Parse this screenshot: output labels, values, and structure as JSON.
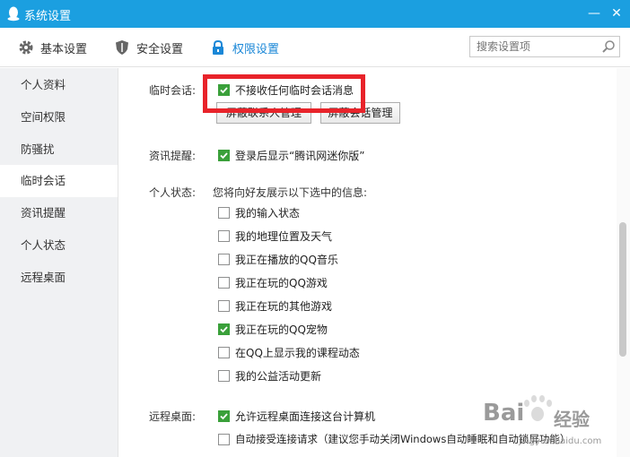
{
  "window": {
    "title": "系统设置",
    "minimize_glyph": "—",
    "close_glyph": "✕"
  },
  "toolbar": {
    "tabs": [
      {
        "label": "基本设置",
        "icon": "gear-icon"
      },
      {
        "label": "安全设置",
        "icon": "shield-icon"
      },
      {
        "label": "权限设置",
        "icon": "lock-icon"
      }
    ],
    "active_tab": 2,
    "search_placeholder": "搜索设置项"
  },
  "sidebar": {
    "items": [
      "个人资料",
      "空间权限",
      "防骚扰",
      "临时会话",
      "资讯提醒",
      "个人状态",
      "远程桌面"
    ],
    "active_index": 3
  },
  "sections": {
    "temp_session": {
      "label": "临时会话:",
      "option": {
        "text": "不接收任何临时会话消息",
        "checked": true
      },
      "buttons": [
        "屏蔽联系人管理",
        "屏蔽会话管理"
      ]
    },
    "news": {
      "label": "资讯提醒:",
      "option": {
        "text": "登录后显示“腾讯网迷你版”",
        "checked": true
      }
    },
    "status": {
      "label": "个人状态:",
      "intro": "您将向好友展示以下选中的信息:",
      "options": [
        {
          "text": "我的输入状态",
          "checked": false
        },
        {
          "text": "我的地理位置及天气",
          "checked": false
        },
        {
          "text": "我正在播放的QQ音乐",
          "checked": false
        },
        {
          "text": "我正在玩的QQ游戏",
          "checked": false
        },
        {
          "text": "我正在玩的其他游戏",
          "checked": false
        },
        {
          "text": "我正在玩的QQ宠物",
          "checked": true
        },
        {
          "text": "在QQ上显示我的课程动态",
          "checked": false
        },
        {
          "text": "我的公益活动更新",
          "checked": false
        }
      ]
    },
    "remote": {
      "label": "远程桌面:",
      "options": [
        {
          "text": "允许远程桌面连接这台计算机",
          "checked": true
        },
        {
          "text": "自动接受连接请求（建议您手动关闭Windows自动睡眠和自动锁屏功能）",
          "checked": false
        }
      ]
    }
  },
  "watermark": {
    "brand": "Bai",
    "brand2": "经验",
    "url": "jingyan.baidu.com"
  },
  "colors": {
    "titlebar": "#1b9fe0",
    "active_tab": "#1a87d7",
    "checkbox_green": "#3aa03a",
    "highlight": "#e8232a"
  }
}
